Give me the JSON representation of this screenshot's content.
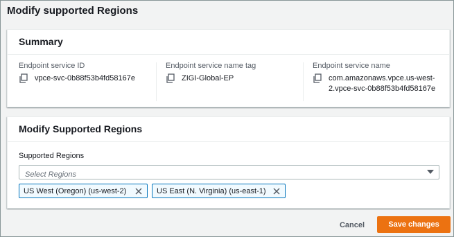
{
  "modal": {
    "title": "Modify supported Regions"
  },
  "summary": {
    "title": "Summary",
    "fields": [
      {
        "label": "Endpoint service ID",
        "value": "vpce-svc-0b88f53b4fd58167e",
        "icon": "copy-icon"
      },
      {
        "label": "Endpoint service name tag",
        "value": "ZIGI-Global-EP",
        "icon": "copy-icon"
      },
      {
        "label": "Endpoint service name",
        "value_line1": "com.amazonaws.vpce.us-west-",
        "value_line2": "2.vpce-svc-0b88f53b4fd58167e",
        "icon": "copy-icon"
      }
    ]
  },
  "modify": {
    "title": "Modify Supported Regions",
    "field_label": "Supported Regions",
    "select_placeholder": "Select Regions",
    "tokens": [
      {
        "label": "US West (Oregon) (us-west-2)",
        "icon": "close-icon"
      },
      {
        "label": "US East (N. Virginia) (us-east-1)",
        "icon": "close-icon"
      }
    ]
  },
  "footer": {
    "cancel_label": "Cancel",
    "save_label": "Save changes"
  },
  "colors": {
    "primary_button": "#ec7211",
    "token_border": "#0073bb",
    "token_bg": "#f1faff"
  }
}
